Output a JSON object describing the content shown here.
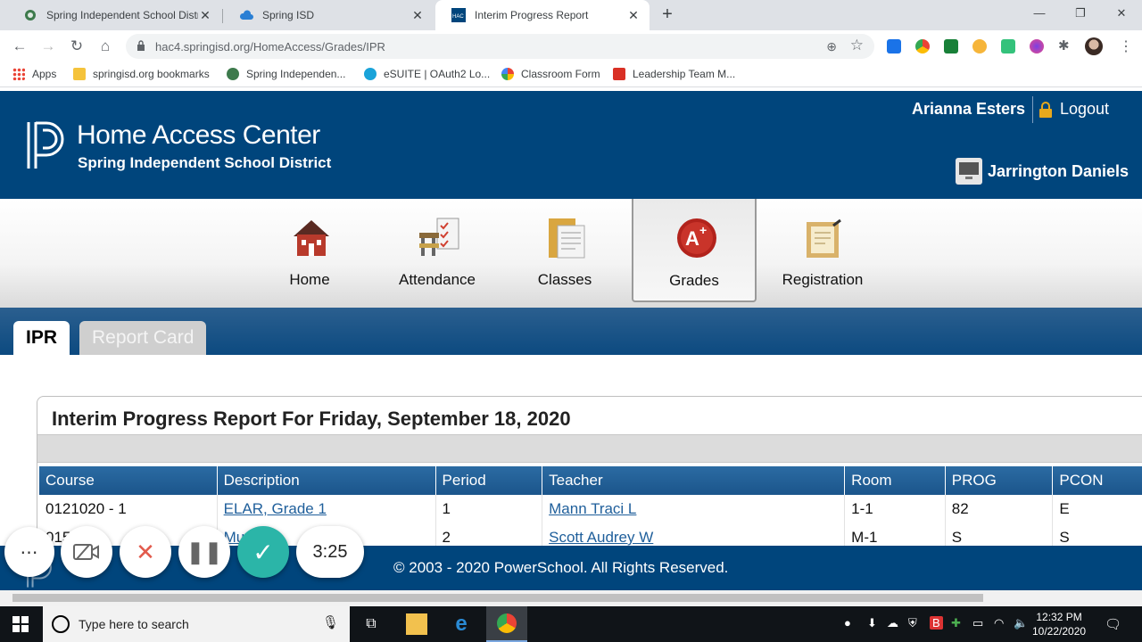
{
  "browser": {
    "tabs": [
      {
        "title": "Spring Independent School Distr"
      },
      {
        "title": "Spring ISD"
      },
      {
        "title": "Interim Progress Report"
      }
    ],
    "url": "hac4.springisd.org/HomeAccess/Grades/IPR",
    "bookmarks": [
      "Apps",
      "springisd.org bookmarks",
      "Spring Independen...",
      "eSUITE | OAuth2 Lo...",
      "Classroom Form",
      "Leadership Team M..."
    ]
  },
  "hac": {
    "title": "Home Access Center",
    "district": "Spring Independent School District",
    "user": "Arianna Esters",
    "logout": "Logout",
    "student": "Jarrington Daniels",
    "nav": [
      "Home",
      "Attendance",
      "Classes",
      "Grades",
      "Registration"
    ],
    "tabs": [
      "IPR",
      "Report Card"
    ],
    "report_title": "Interim Progress Report For Friday, September 18, 2020",
    "columns": [
      "Course",
      "Description",
      "Period",
      "Teacher",
      "Room",
      "PROG",
      "PCON"
    ],
    "rows": [
      {
        "course": "0121020 - 1",
        "description": "ELAR, Grade 1",
        "period": "1",
        "teacher": "Mann Traci L",
        "room": "1-1",
        "prog": "82",
        "pcon": "E"
      },
      {
        "course": "015",
        "description": "Mu",
        "period": "2",
        "teacher": "Scott Audrey W",
        "room": "M-1",
        "prog": "S",
        "pcon": "S"
      }
    ],
    "footer": "© 2003 - 2020 PowerSchool. All Rights Reserved."
  },
  "recorder": {
    "timer": "3:25",
    "icons": [
      "more-icon",
      "camera-off-icon",
      "cancel-icon",
      "pause-icon",
      "done-icon"
    ]
  },
  "taskbar": {
    "search_placeholder": "Type here to search",
    "time": "12:32 PM",
    "date": "10/22/2020"
  }
}
